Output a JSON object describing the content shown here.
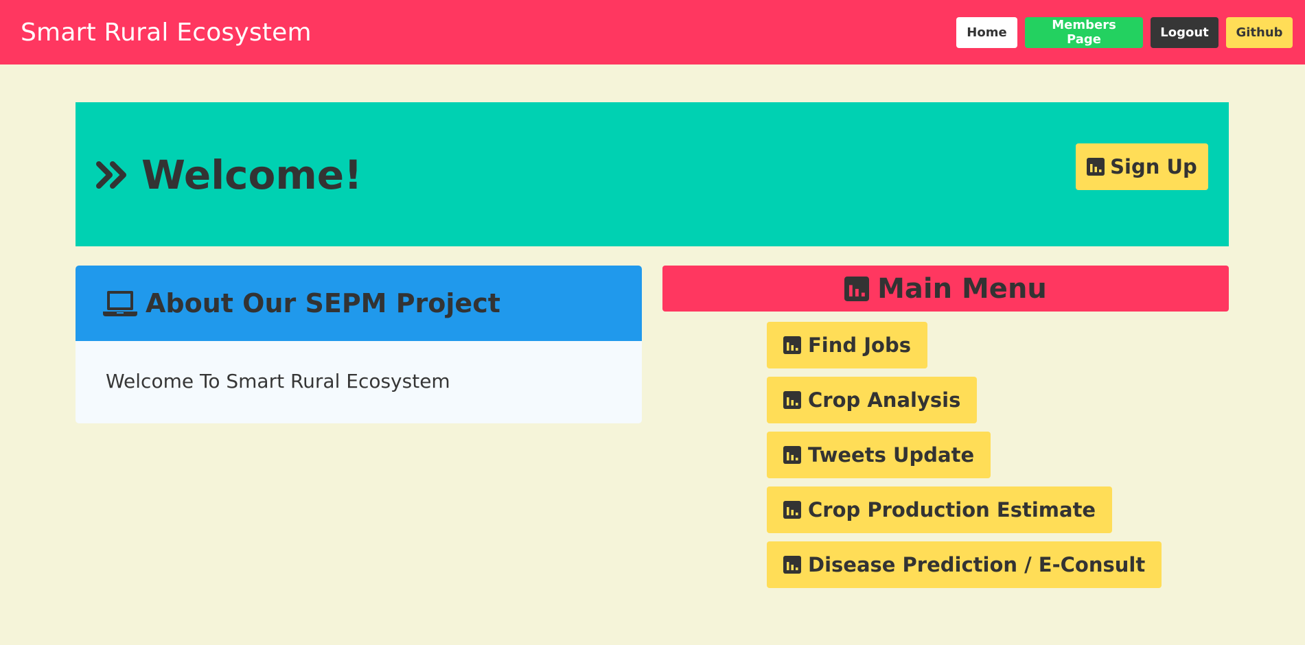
{
  "navbar": {
    "brand": "Smart Rural Ecosystem",
    "buttons": {
      "home": "Home",
      "members": "Members Page",
      "logout": "Logout",
      "github": "Github"
    }
  },
  "hero": {
    "title": "Welcome!",
    "signup_label": "Sign Up"
  },
  "about": {
    "title": "About Our SEPM Project",
    "body": "Welcome To Smart Rural Ecosystem"
  },
  "menu": {
    "title": "Main Menu",
    "items": [
      {
        "label": "Find Jobs"
      },
      {
        "label": "Crop Analysis"
      },
      {
        "label": "Tweets Update"
      },
      {
        "label": "Crop Production Estimate"
      },
      {
        "label": "Disease Prediction / E-Consult"
      }
    ]
  },
  "colors": {
    "navbar": "#ff3760",
    "hero": "#00d1b2",
    "about_header": "#2099ec",
    "menu_header": "#ff3760",
    "button_yellow": "#ffdd57",
    "button_green": "#23d160",
    "button_dark": "#363636",
    "page_background": "#f5f4d9"
  },
  "icons": {
    "hero": "angle-double-right-icon",
    "buttons": "chart-bar-icon",
    "about": "laptop-icon"
  }
}
